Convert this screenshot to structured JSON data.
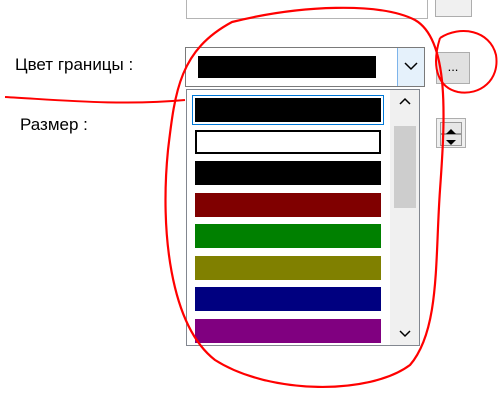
{
  "labels": {
    "border_color": "Цвет границы :",
    "size": "Размер :"
  },
  "more_button": {
    "label": "..."
  },
  "combo": {
    "selected_color": "#000000",
    "arrow_icon": "chevron-down-icon"
  },
  "dropdown": {
    "items": [
      {
        "color": "#000000",
        "selected": true
      },
      {
        "color": "#ffffff",
        "selected": false
      },
      {
        "color": "#000000",
        "selected": false
      },
      {
        "color": "#800000",
        "selected": false
      },
      {
        "color": "#008000",
        "selected": false
      },
      {
        "color": "#808000",
        "selected": false
      },
      {
        "color": "#000080",
        "selected": false
      },
      {
        "color": "#800080",
        "selected": false
      }
    ],
    "scroll_up_icon": "chevron-up-icon",
    "scroll_down_icon": "chevron-down-icon"
  },
  "colors": {
    "accent": "#0078d7",
    "annotation": "#ff0000"
  }
}
